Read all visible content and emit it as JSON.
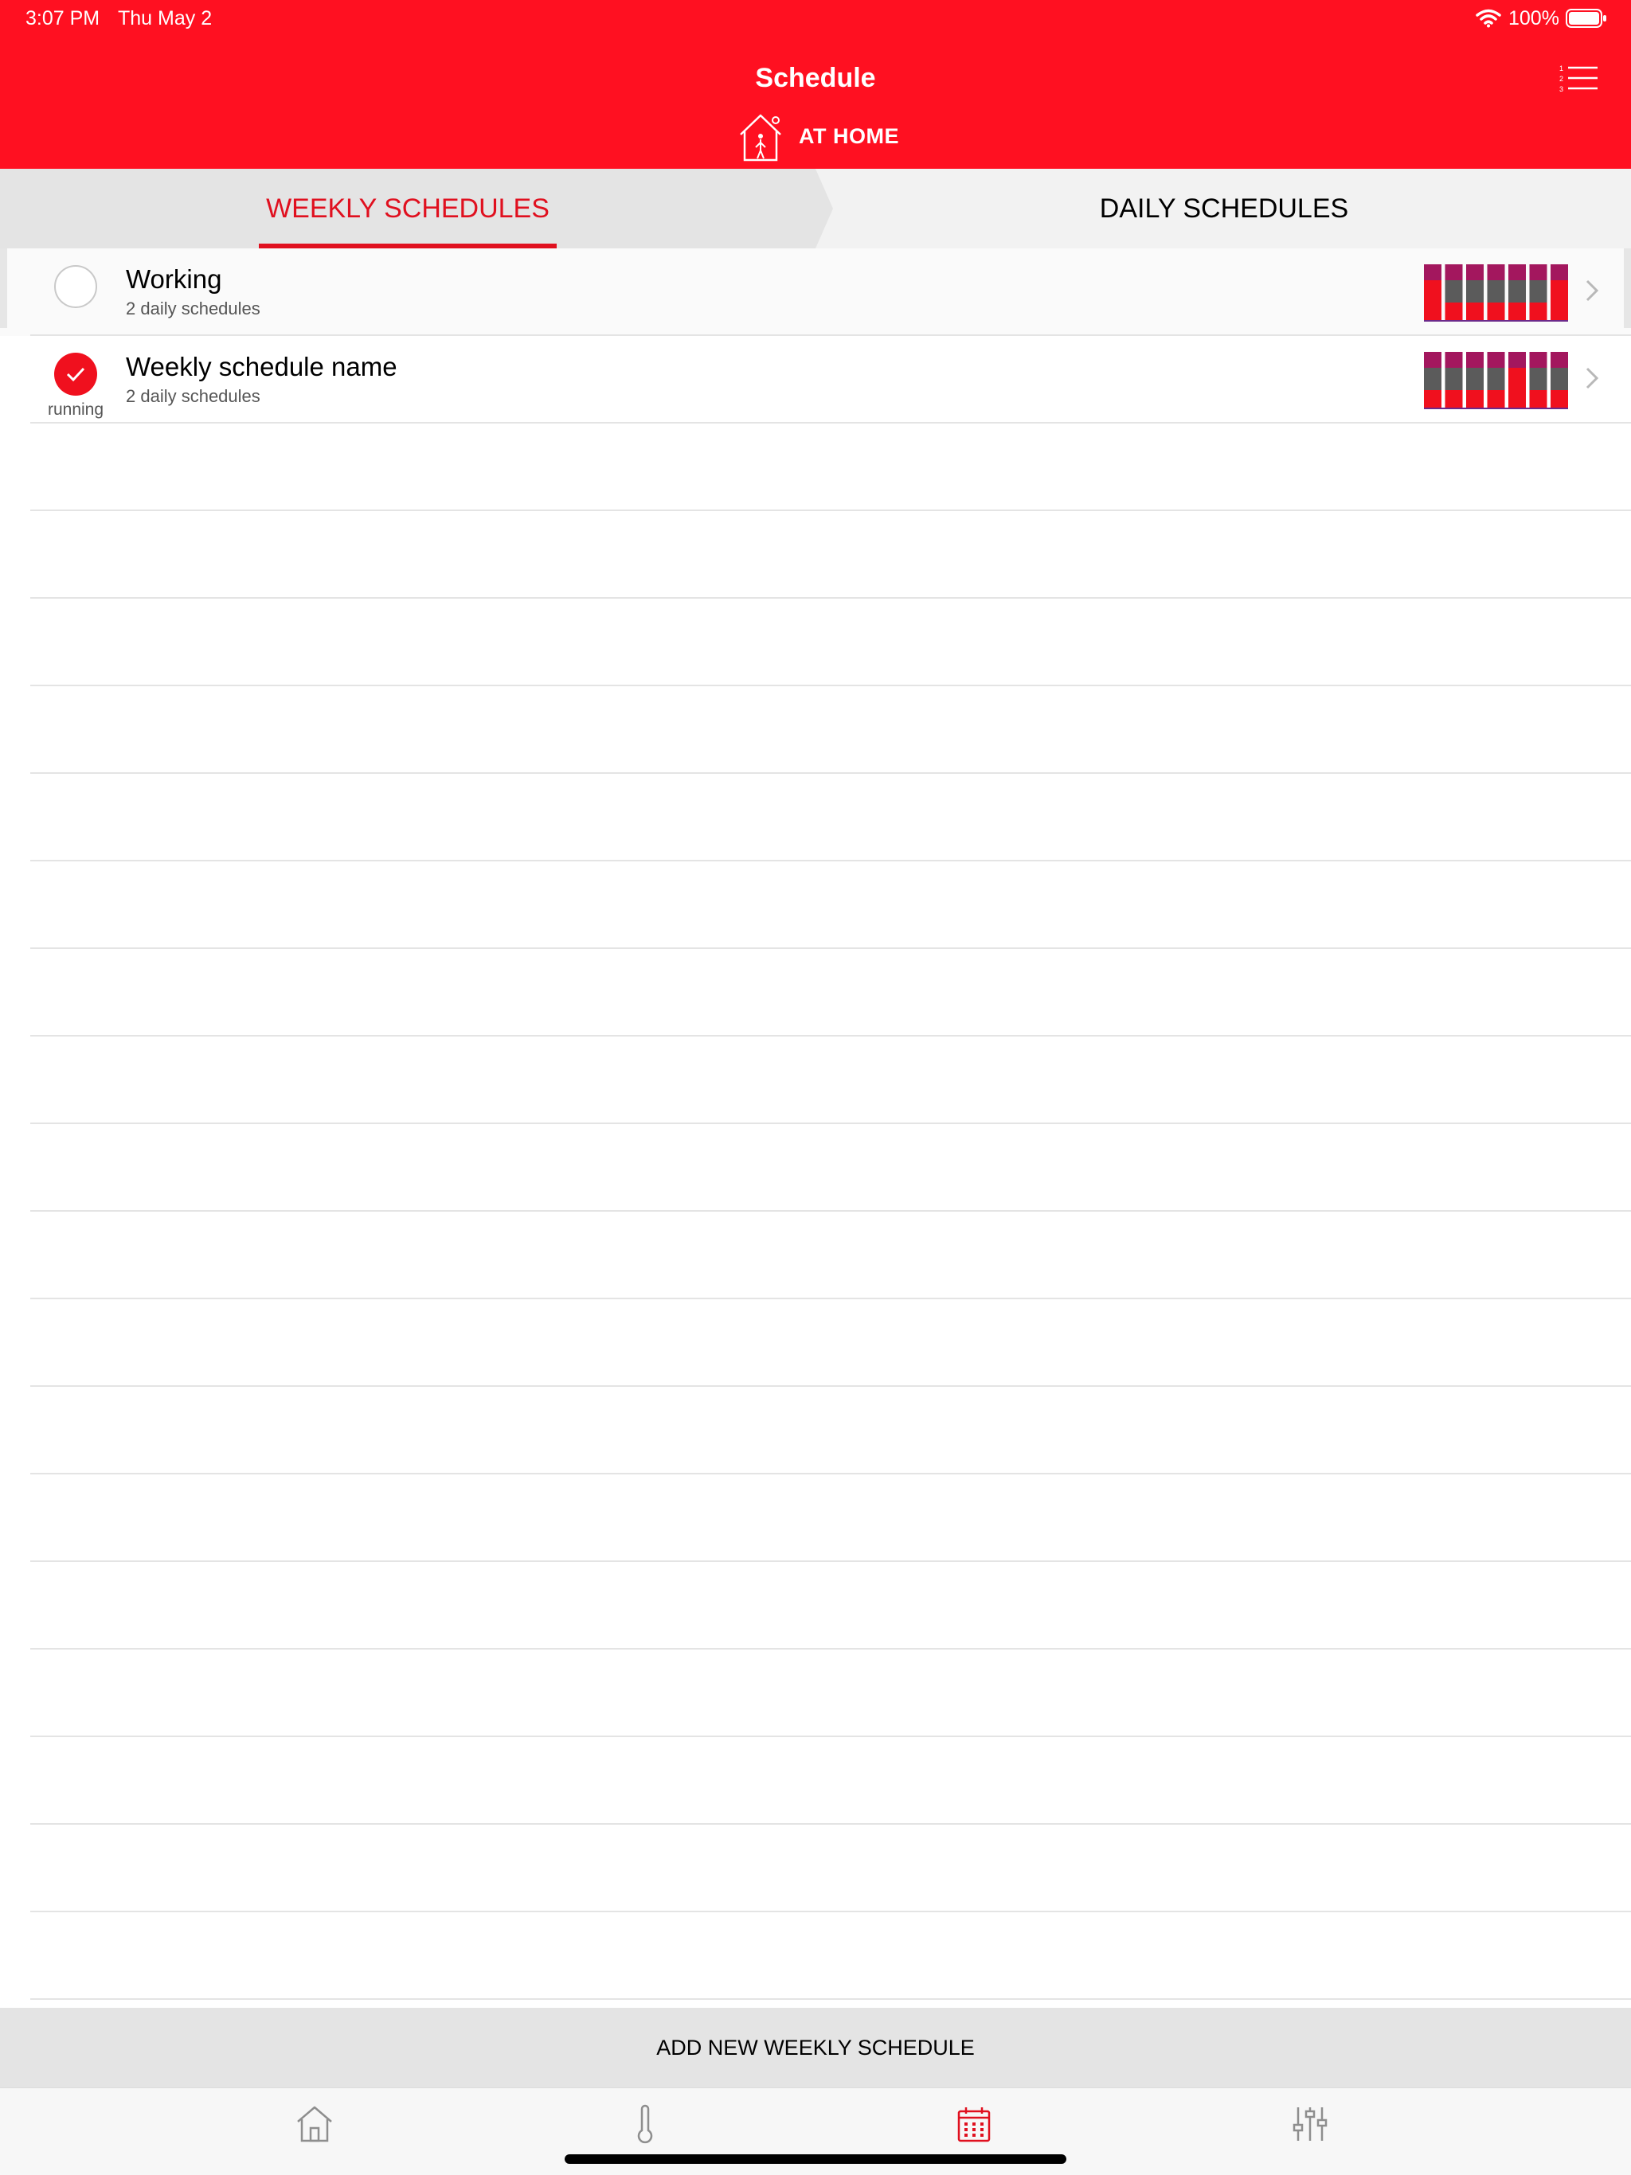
{
  "status_bar": {
    "time": "3:07 PM",
    "date": "Thu May 2",
    "battery": "100%"
  },
  "header": {
    "title": "Schedule",
    "mode_label": "AT HOME",
    "mode_icon": "house-person-icon",
    "menu_icon": "numbered-list-icon"
  },
  "tabs": [
    {
      "label": "WEEKLY SCHEDULES",
      "active": true
    },
    {
      "label": "DAILY SCHEDULES",
      "active": false
    }
  ],
  "schedules": [
    {
      "name": "Working",
      "subtitle": "2 daily schedules",
      "running": false,
      "status_label": ""
    },
    {
      "name": "Weekly schedule name",
      "subtitle": "2 daily schedules",
      "running": true,
      "status_label": "running"
    }
  ],
  "add_button_label": "ADD NEW WEEKLY SCHEDULE",
  "bottom_nav": [
    {
      "icon": "home-icon",
      "active": false
    },
    {
      "icon": "thermometer-icon",
      "active": false
    },
    {
      "icon": "calendar-icon",
      "active": true
    },
    {
      "icon": "sliders-icon",
      "active": false
    }
  ],
  "colors": {
    "brand_red": "#ff1021",
    "accent_red": "#e0101f",
    "preview_magenta": "#a3175e",
    "preview_gray": "#5b5b5b",
    "preview_red": "#f0101e"
  }
}
